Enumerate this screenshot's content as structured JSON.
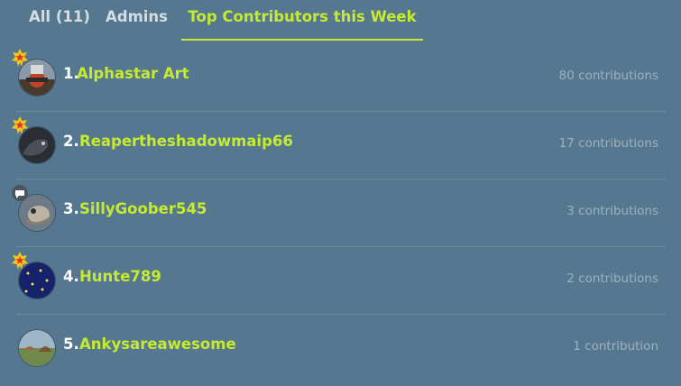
{
  "tabs": [
    {
      "label": "All (11)",
      "active": false
    },
    {
      "label": "Admins",
      "active": false
    },
    {
      "label": "Top Contributors this Week",
      "active": true
    }
  ],
  "contributors": [
    {
      "rank": "1.",
      "name": "Alphastar Art",
      "contributions": "80 contributions",
      "badge": "star-badge-icon"
    },
    {
      "rank": "2.",
      "name": "Reapertheshadowmaip66",
      "contributions": "17 contributions",
      "badge": "star-badge-icon"
    },
    {
      "rank": "3.",
      "name": "SillyGoober545",
      "contributions": "3 contributions",
      "badge": "chat-badge-icon"
    },
    {
      "rank": "4.",
      "name": "Hunte789",
      "contributions": "2 contributions",
      "badge": "star-badge-icon"
    },
    {
      "rank": "5.",
      "name": "Ankysareawesome",
      "contributions": "1 contribution",
      "badge": ""
    }
  ],
  "colors": {
    "background": "#557890",
    "accent": "#c6ea2f",
    "muted": "#9db1bf",
    "badge_gold": "#f5c518",
    "badge_red": "#e0312d"
  }
}
